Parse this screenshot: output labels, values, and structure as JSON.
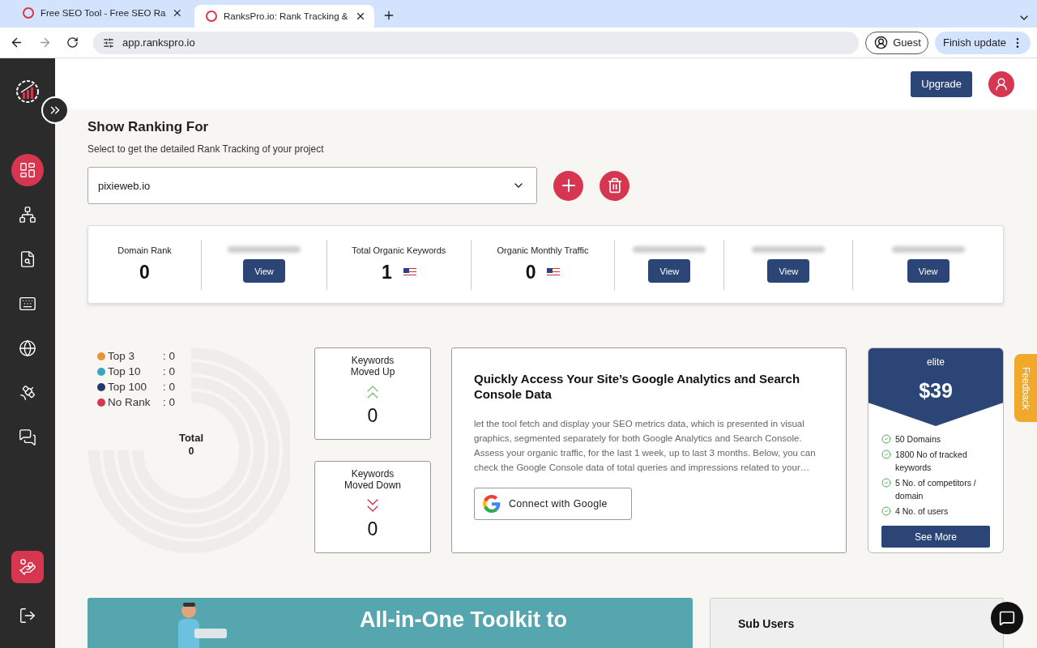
{
  "browser": {
    "tabs": [
      {
        "title": "Free SEO Tool - Free SEO Ra",
        "selected": false
      },
      {
        "title": "RanksPro.io: Rank Tracking &",
        "selected": true
      }
    ],
    "address": "app.rankspro.io",
    "profile": "Guest",
    "update_button": "Finish update"
  },
  "sidebar": {
    "items": [
      {
        "selected": true
      },
      {
        "selected": false
      },
      {
        "selected": false
      },
      {
        "selected": false
      },
      {
        "selected": false
      },
      {
        "selected": false
      },
      {
        "selected": false
      }
    ],
    "bottom_items": [
      {
        "selected": true
      },
      {
        "selected": false
      }
    ]
  },
  "header": {
    "upgrade_button": "Upgrade"
  },
  "ranking": {
    "title": "Show Ranking For",
    "subtitle": "Select to get the detailed Rank Tracking of your project",
    "project": "pixieweb.io"
  },
  "stats": [
    {
      "kind": "value",
      "label": "Domain Rank",
      "value": "0",
      "flag": false
    },
    {
      "kind": "locked",
      "button": "View"
    },
    {
      "kind": "value",
      "label": "Total Organic Keywords",
      "value": "1",
      "flag": true
    },
    {
      "kind": "value",
      "label": "Organic Monthly Traffic",
      "value": "0",
      "flag": true
    },
    {
      "kind": "locked",
      "button": "View"
    },
    {
      "kind": "locked",
      "button": "View"
    },
    {
      "kind": "locked",
      "button": "View"
    }
  ],
  "legend": [
    {
      "label": "Top 3",
      "value": ": 0",
      "color": "#e8953a"
    },
    {
      "label": "Top 10",
      "value": ": 0",
      "color": "#3aa6c4"
    },
    {
      "label": "Top 100",
      "value": ": 0",
      "color": "#253a6b"
    },
    {
      "label": "No Rank",
      "value": ": 0",
      "color": "#d6364f"
    }
  ],
  "total": {
    "label": "Total",
    "value": "0"
  },
  "movement": [
    {
      "kind": "up",
      "title": "Keywords Moved Up",
      "value": "0"
    },
    {
      "kind": "down",
      "title": "Keywords Moved Down",
      "value": "0"
    }
  ],
  "analytics": {
    "title": "Quickly Access Your Site’s Google Analytics and Search Console Data",
    "text": "let the tool fetch and display your SEO metrics data, which is presented in visual graphics, segmented separately for both Google Analytics and Search Console. Assess your organic traffic, for the last 1 week, up to last 3 months. Below, you can check the Google Console data of total queries and impressions related to your…",
    "button": "Connect with Google"
  },
  "plan": {
    "name": "elite",
    "price": "$39",
    "features": [
      "50 Domains",
      "1800 No of tracked keywords",
      "5 No. of competitors / domain",
      "4 No. of users"
    ],
    "button": "See More"
  },
  "feedback": "Feedback",
  "banner": {
    "lines": [
      "All-in-One Toolkit to"
    ]
  },
  "sub_users": {
    "title": "Sub Users"
  }
}
